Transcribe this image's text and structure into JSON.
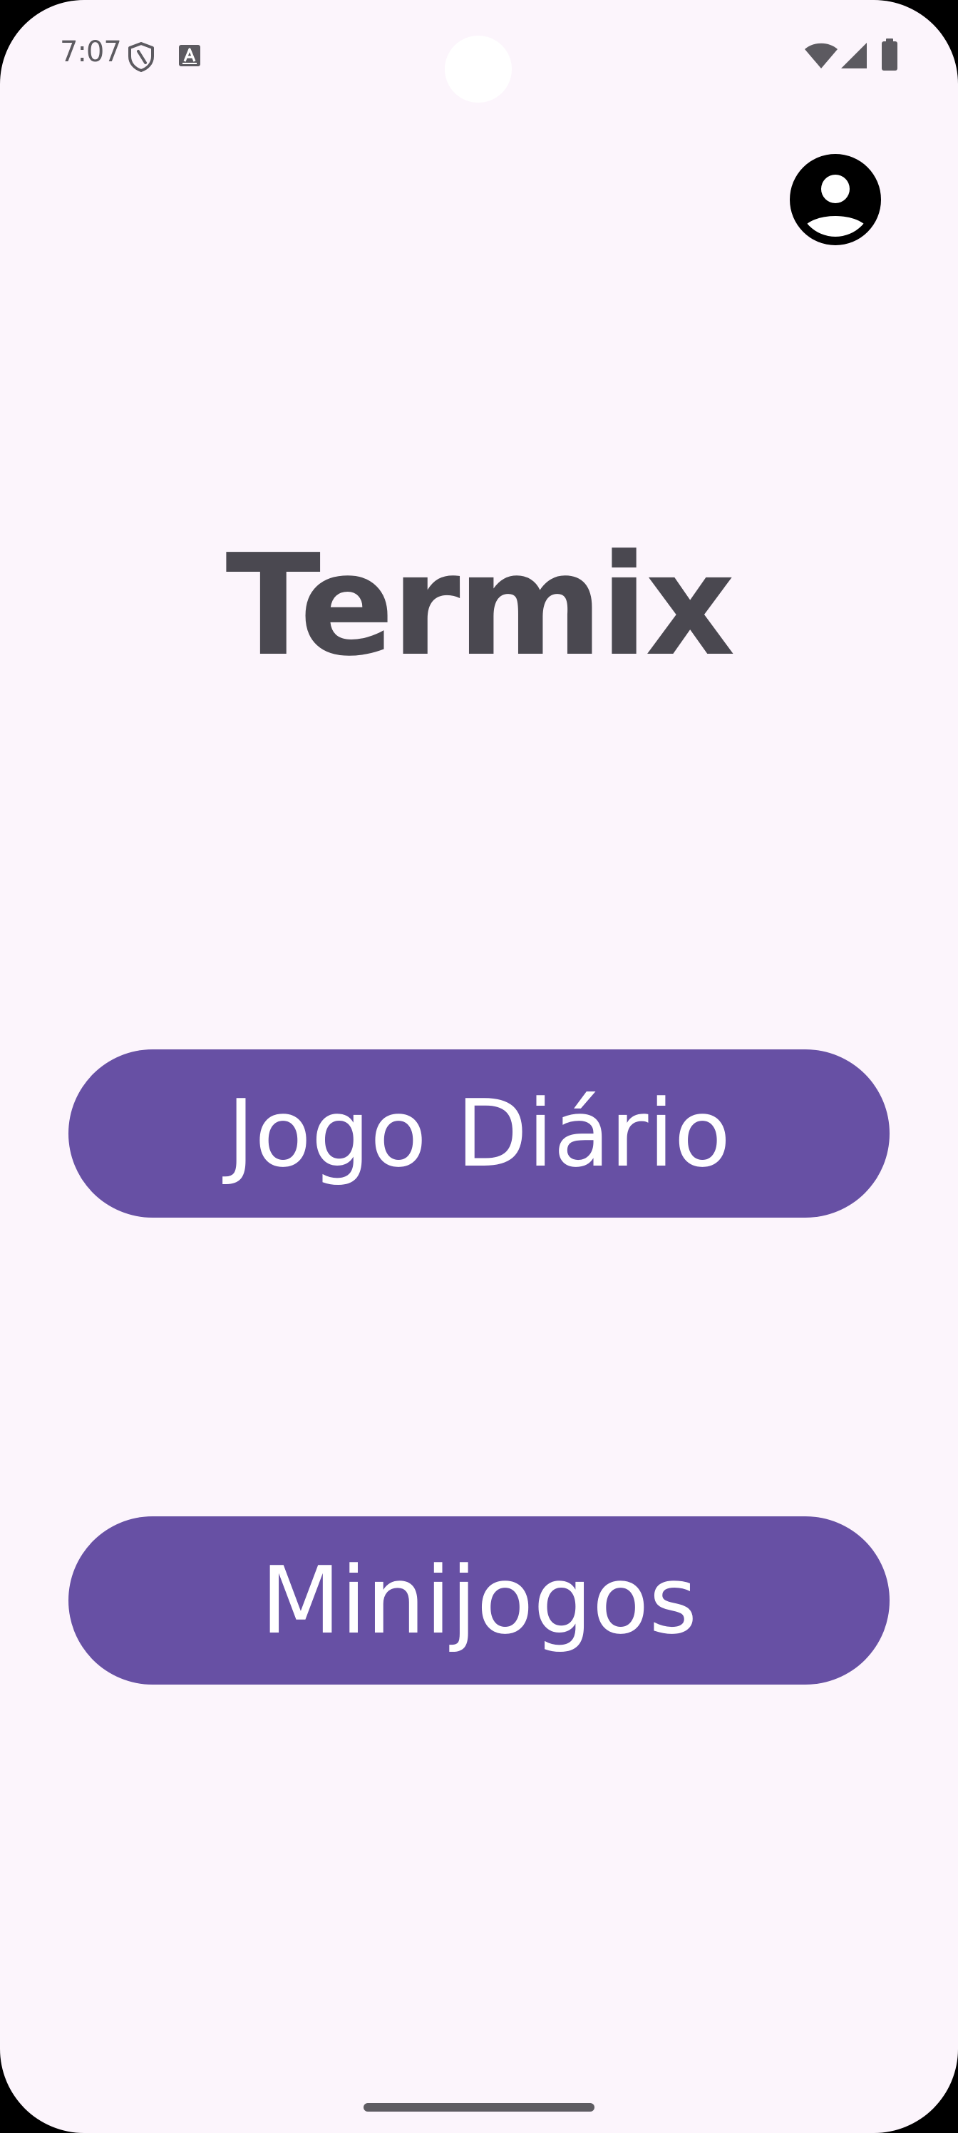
{
  "status_bar": {
    "time": "7:07",
    "left_icons": [
      "shield-icon",
      "keyboard-a-icon"
    ],
    "right_icons": [
      "wifi-icon",
      "cellular-signal-icon",
      "battery-icon"
    ]
  },
  "header": {
    "profile_icon": "account-circle-icon"
  },
  "main": {
    "title": "Termix",
    "buttons": {
      "daily_game_label": "Jogo Diário",
      "minigames_label": "Minijogos"
    }
  },
  "colors": {
    "background": "#fcf5fc",
    "primary": "#6750a4",
    "title_text": "#4a4850",
    "on_primary": "#ffffff"
  }
}
